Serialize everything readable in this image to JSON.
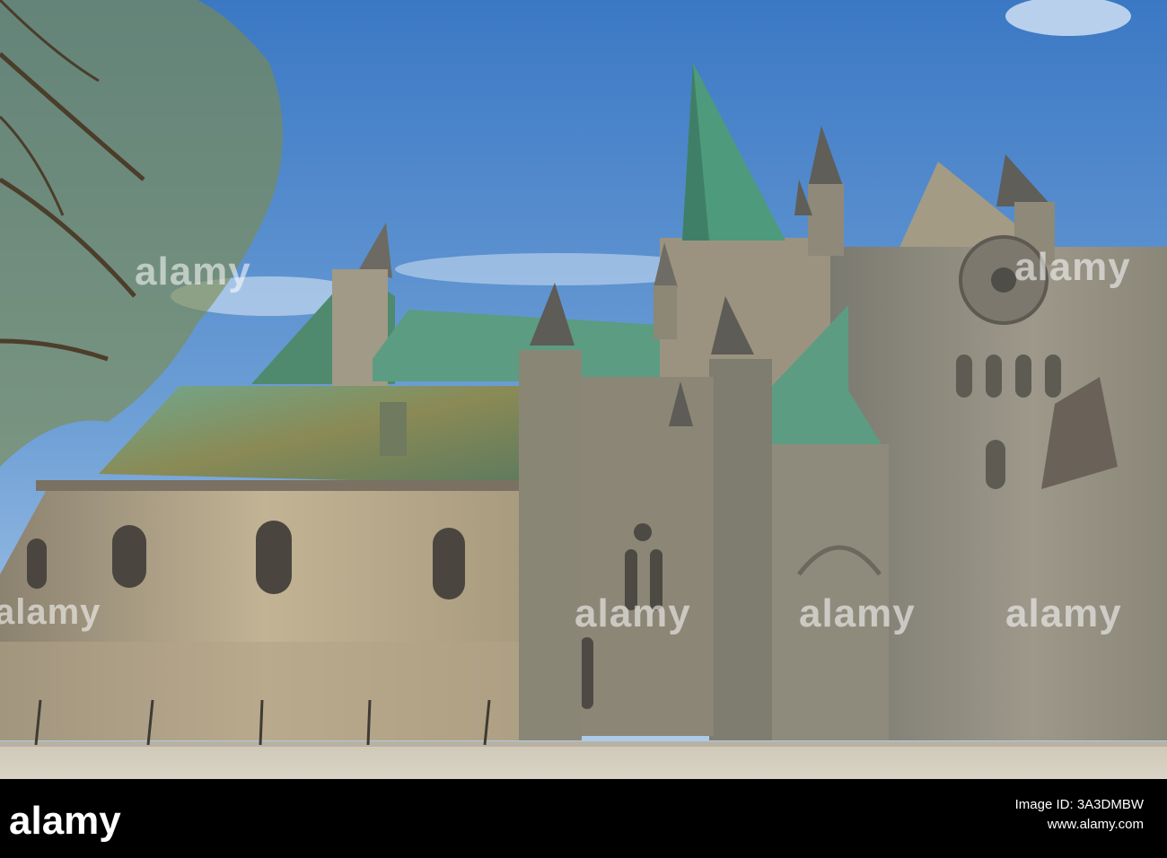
{
  "watermark": {
    "brand": "alamy",
    "footer_line1": "Image ID: 3A3DMBW",
    "footer_line2": "www.alamy.com"
  },
  "colors": {
    "sky_top": "#3f7ec9",
    "sky_bottom": "#a9c8e8",
    "copper_roof": "#5e9b82",
    "stone_light": "#b6a78a",
    "stone_dark": "#7d7b70",
    "road": "#d1cbbd",
    "footer": "#000000"
  }
}
